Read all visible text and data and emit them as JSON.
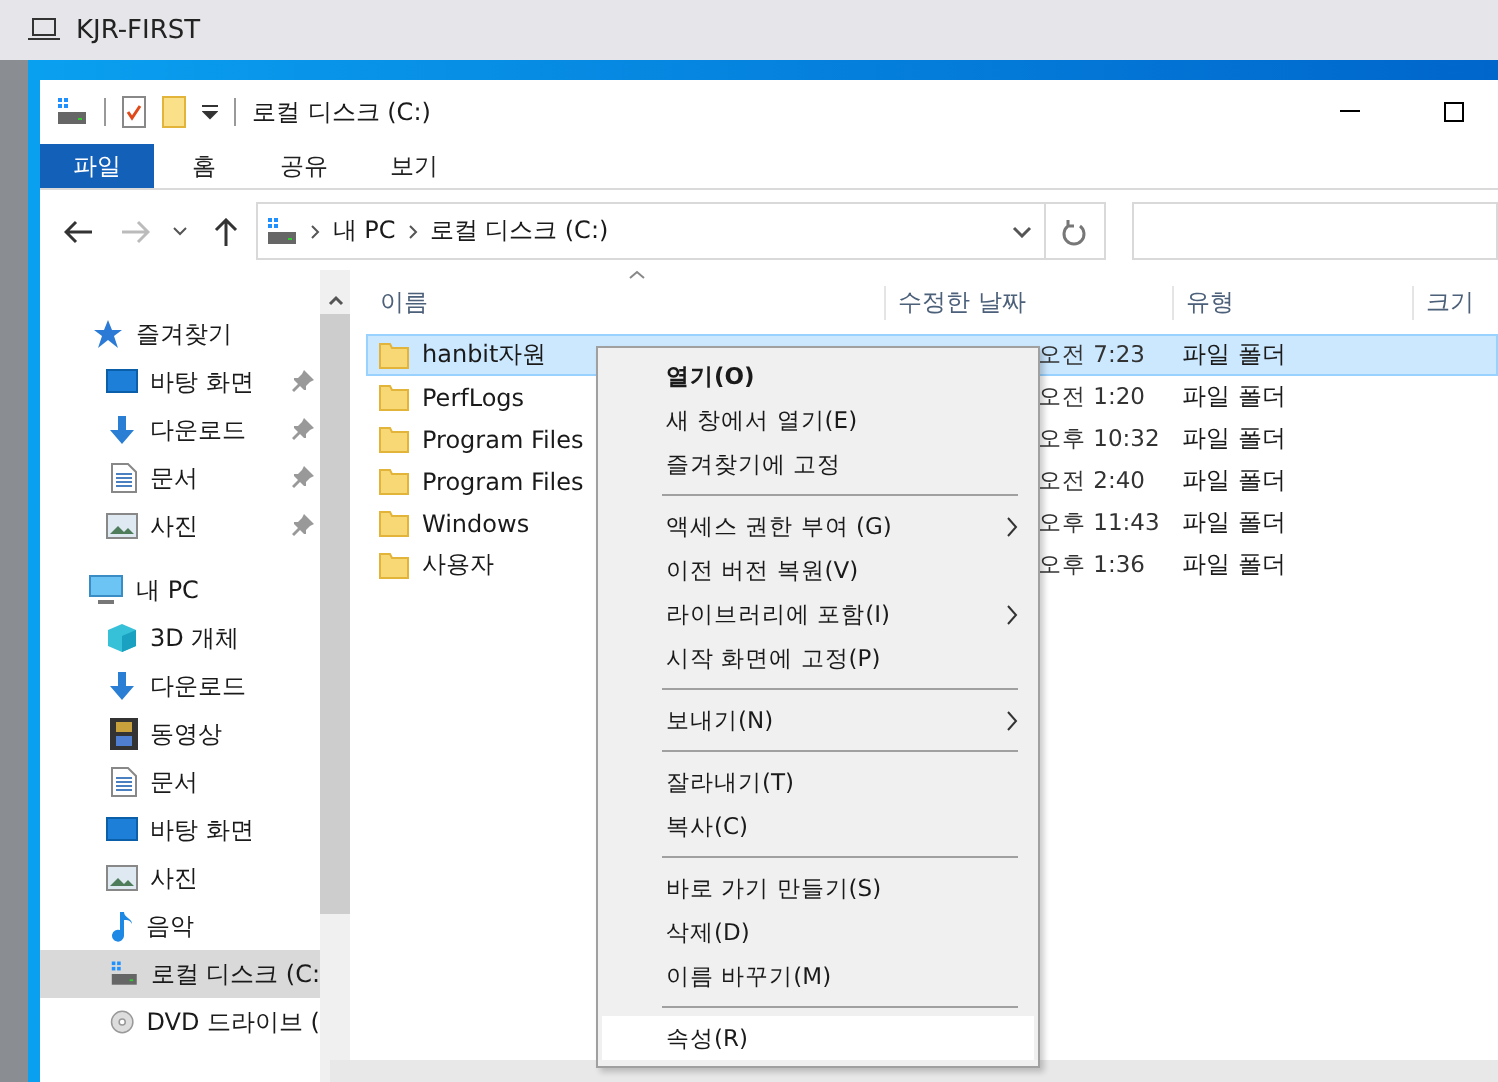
{
  "window": {
    "title": "KJR-FIRST"
  },
  "explorer": {
    "title": "로컬 디스크 (C:)"
  },
  "ribbon_tabs": [
    {
      "label": "파일",
      "selected": true
    },
    {
      "label": "홈",
      "selected": false
    },
    {
      "label": "공유",
      "selected": false
    },
    {
      "label": "보기",
      "selected": false
    }
  ],
  "address_bar": {
    "path": [
      "내 PC",
      "로컬 디스크 (C:)"
    ]
  },
  "navigation": [
    {
      "label": "즐겨찾기",
      "kind": "star",
      "children": [
        {
          "label": "바탕 화면",
          "kind": "desktop",
          "pinned": true,
          "selected": false
        },
        {
          "label": "다운로드",
          "kind": "download",
          "pinned": true,
          "selected": false
        },
        {
          "label": "문서",
          "kind": "document",
          "pinned": true,
          "selected": false
        },
        {
          "label": "사진",
          "kind": "photo",
          "pinned": true,
          "selected": false
        }
      ]
    },
    {
      "label": "내 PC",
      "kind": "pc",
      "children": [
        {
          "label": "3D 개체",
          "kind": "cube",
          "pinned": false,
          "selected": false
        },
        {
          "label": "다운로드",
          "kind": "download",
          "pinned": false,
          "selected": false
        },
        {
          "label": "동영상",
          "kind": "video",
          "pinned": false,
          "selected": false
        },
        {
          "label": "문서",
          "kind": "document",
          "pinned": false,
          "selected": false
        },
        {
          "label": "바탕 화면",
          "kind": "desktop",
          "pinned": false,
          "selected": false
        },
        {
          "label": "사진",
          "kind": "photo",
          "pinned": false,
          "selected": false
        },
        {
          "label": "음악",
          "kind": "music",
          "pinned": false,
          "selected": false
        },
        {
          "label": "로컬 디스크 (C:",
          "kind": "drive",
          "pinned": false,
          "selected": true
        },
        {
          "label": "DVD 드라이브 (",
          "kind": "dvd",
          "pinned": false,
          "selected": false
        }
      ]
    }
  ],
  "columns": [
    "이름",
    "수정한 날짜",
    "유형",
    "크기"
  ],
  "rows": [
    {
      "name": "hanbit자원",
      "date": "오전 7:23",
      "type": "파일 폴더",
      "selected": true
    },
    {
      "name": "PerfLogs",
      "date": "오전 1:20",
      "type": "파일 폴더",
      "selected": false
    },
    {
      "name": "Program Files",
      "date": "오후 10:32",
      "type": "파일 폴더",
      "selected": false
    },
    {
      "name": "Program Files",
      "date": "오전 2:40",
      "type": "파일 폴더",
      "selected": false
    },
    {
      "name": "Windows",
      "date": "오후 11:43",
      "type": "파일 폴더",
      "selected": false
    },
    {
      "name": "사용자",
      "date": "오후 1:36",
      "type": "파일 폴더",
      "selected": false
    }
  ],
  "context_menu": {
    "groups": [
      [
        {
          "label": "열기(O)",
          "default": true,
          "submenu": false,
          "selected": false
        },
        {
          "label": "새 창에서 열기(E)",
          "default": false,
          "submenu": false,
          "selected": false
        },
        {
          "label": "즐겨찾기에 고정",
          "default": false,
          "submenu": false,
          "selected": false
        }
      ],
      [
        {
          "label": "액세스 권한 부여 (G)",
          "default": false,
          "submenu": true,
          "selected": false
        },
        {
          "label": "이전 버전 복원(V)",
          "default": false,
          "submenu": false,
          "selected": false
        },
        {
          "label": "라이브러리에 포함(I)",
          "default": false,
          "submenu": true,
          "selected": false
        },
        {
          "label": "시작 화면에 고정(P)",
          "default": false,
          "submenu": false,
          "selected": false
        }
      ],
      [
        {
          "label": "보내기(N)",
          "default": false,
          "submenu": true,
          "selected": false
        }
      ],
      [
        {
          "label": "잘라내기(T)",
          "default": false,
          "submenu": false,
          "selected": false
        },
        {
          "label": "복사(C)",
          "default": false,
          "submenu": false,
          "selected": false
        }
      ],
      [
        {
          "label": "바로 가기 만들기(S)",
          "default": false,
          "submenu": false,
          "selected": false
        },
        {
          "label": "삭제(D)",
          "default": false,
          "submenu": false,
          "selected": false
        },
        {
          "label": "이름 바꾸기(M)",
          "default": false,
          "submenu": false,
          "selected": false
        }
      ],
      [
        {
          "label": "속성(R)",
          "default": false,
          "submenu": false,
          "selected": true
        }
      ]
    ]
  }
}
